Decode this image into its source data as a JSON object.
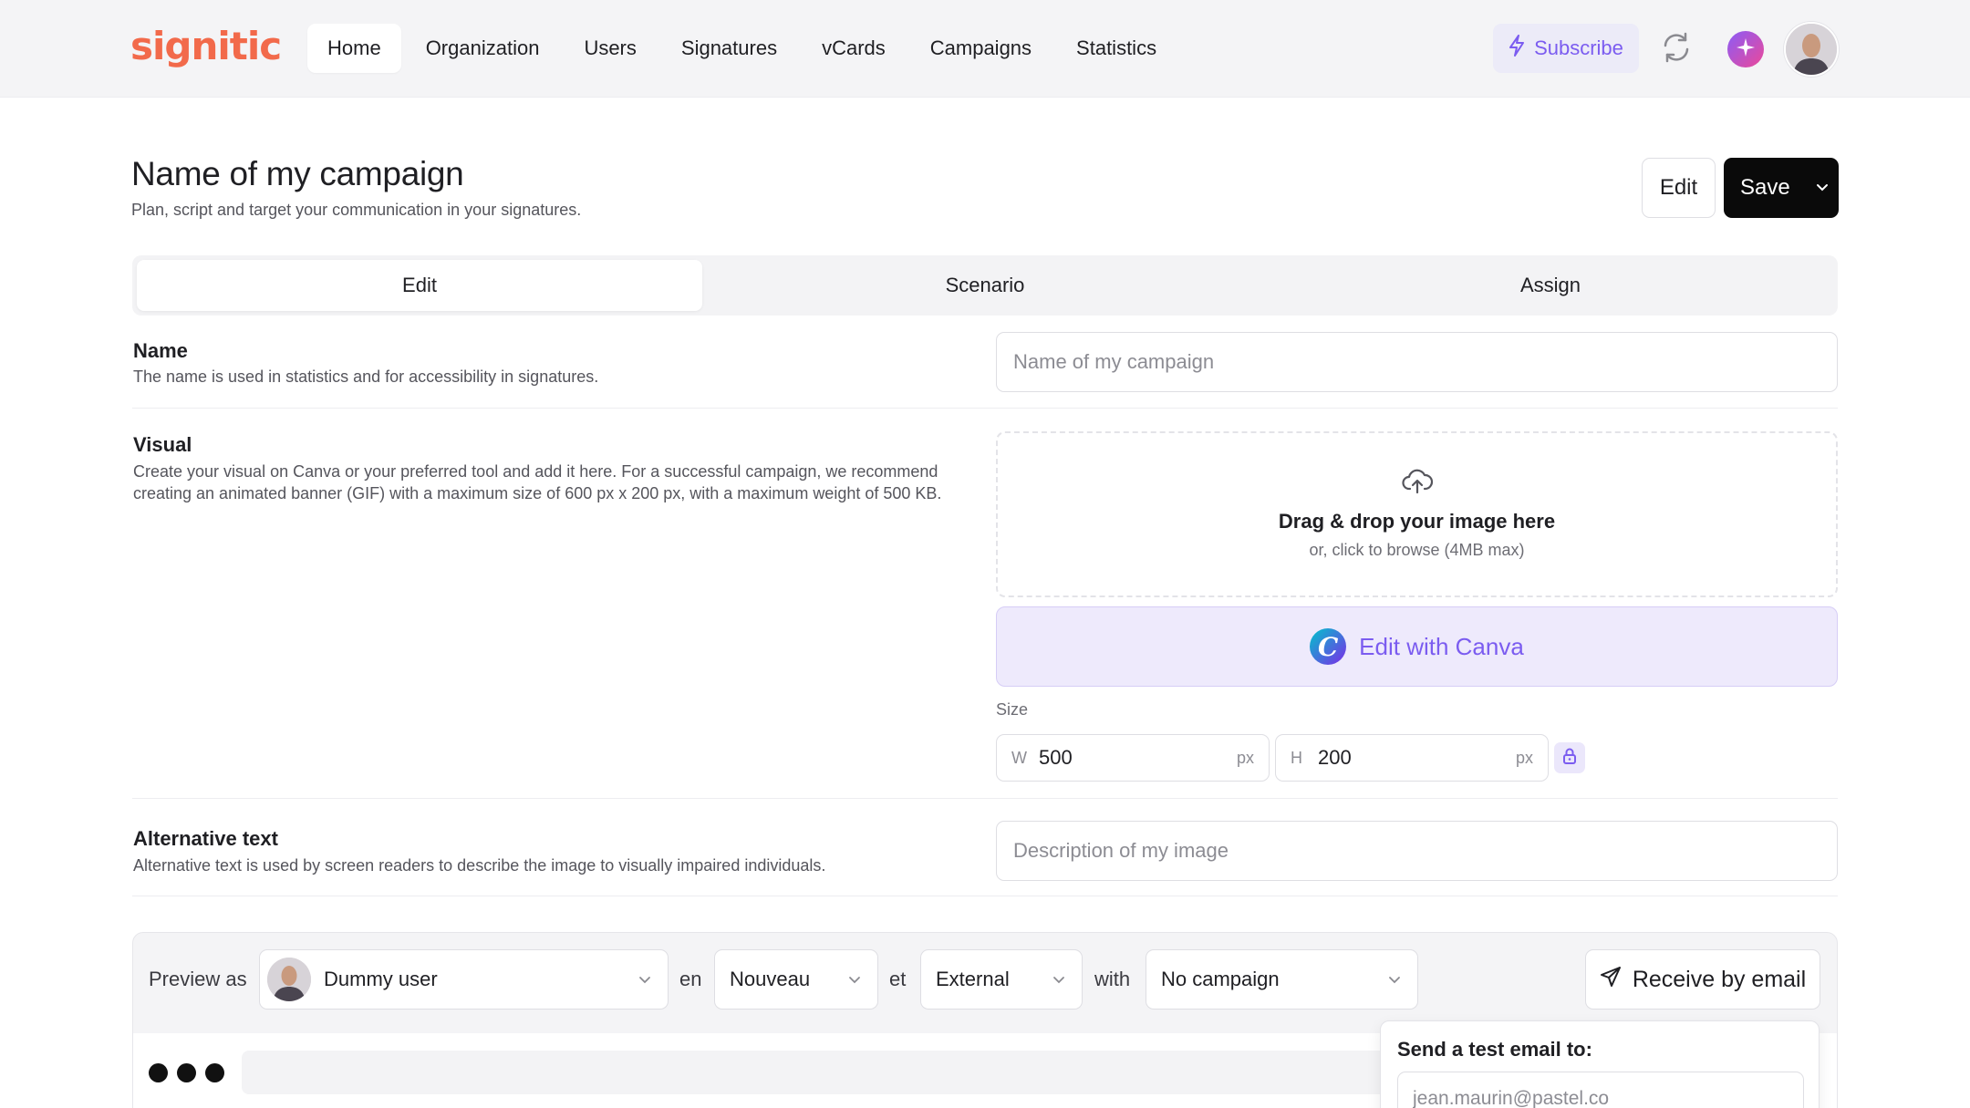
{
  "brand": {
    "logo_text": "signitic",
    "accent": "#f26a4b",
    "purple": "#7b5cf0"
  },
  "nav": {
    "items": [
      "Home",
      "Organization",
      "Users",
      "Signatures",
      "vCards",
      "Campaigns",
      "Statistics"
    ],
    "active": "Home",
    "subscribe_label": "Subscribe",
    "icons": {
      "subscribe": "lightning-icon",
      "sync": "sync-icon",
      "ai": "sparkle-icon",
      "avatar": "user-avatar"
    }
  },
  "header": {
    "title": "Name of my campaign",
    "subtitle": "Plan, script and target your communication in your signatures.",
    "edit_label": "Edit",
    "save_label": "Save"
  },
  "tabs": [
    "Edit",
    "Scenario",
    "Assign"
  ],
  "active_tab": "Edit",
  "form": {
    "name": {
      "label": "Name",
      "description": "The name is used in statistics and for accessibility in signatures.",
      "placeholder": "Name of my campaign"
    },
    "visual": {
      "label": "Visual",
      "description": "Create your visual on Canva or your preferred tool and add it here. For a successful campaign, we recommend creating an animated banner (GIF) with a maximum size of 600 px x 200 px, with a maximum weight of 500 KB.",
      "dropzone_title": "Drag & drop your image here",
      "dropzone_sub": "or, click to browse (4MB max)",
      "canva_label": "Edit with Canva",
      "size_label": "Size",
      "width_prefix": "W",
      "width_value": "500",
      "height_prefix": "H",
      "height_value": "200",
      "unit": "px"
    },
    "alt_text": {
      "label": "Alternative text",
      "description": "Alternative text is used by screen readers to describe the image to visually impaired individuals.",
      "placeholder": "Description of my image"
    }
  },
  "preview": {
    "preview_as_label": "Preview as",
    "user_value": "Dummy user",
    "en_label": "en",
    "status_value": "Nouveau",
    "et_label": "et",
    "audience_value": "External",
    "with_label": "with",
    "campaign_value": "No campaign",
    "receive_label": "Receive by email",
    "popover_title": "Send a test email to:",
    "email_placeholder": "jean.maurin@pastel.co"
  }
}
